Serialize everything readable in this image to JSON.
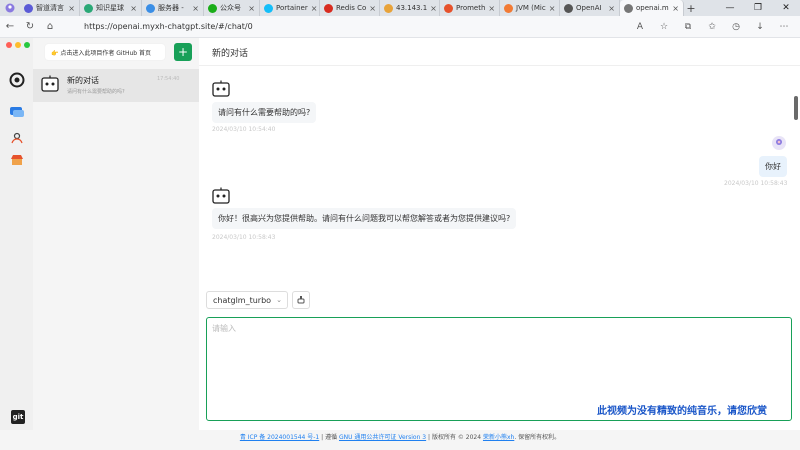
{
  "browser": {
    "tabs": [
      {
        "label": "智道清言",
        "color": "#5b5bd6"
      },
      {
        "label": "知识星球",
        "color": "#2aa876"
      },
      {
        "label": "服务器 - ",
        "color": "#3a8ee6"
      },
      {
        "label": "公众号",
        "color": "#1aad19"
      },
      {
        "label": "Portainer",
        "color": "#13bef9"
      },
      {
        "label": "Redis Co",
        "color": "#d82c20"
      },
      {
        "label": "43.143.1",
        "color": "#e8a33a"
      },
      {
        "label": "Prometh",
        "color": "#e6522c"
      },
      {
        "label": "JVM (Mic",
        "color": "#f27b35"
      },
      {
        "label": "OpenAI",
        "color": "#555555"
      },
      {
        "label": "openai.m",
        "color": "#777777"
      }
    ],
    "active_tab": 10,
    "url": "https://openai.myxh-chatgpt.site/#/chat/0"
  },
  "sidebar": {
    "github_label": "👉 点击进入此项目作者 GitHub 首页",
    "add_label": "+",
    "conversation": {
      "title": "新的对话",
      "time": "17:54:40",
      "subtitle": "请问有什么需要帮助的吗?"
    }
  },
  "main": {
    "title": "新的对话",
    "messages": [
      {
        "role": "bot",
        "text": "请问有什么需要帮助的吗?",
        "time": "2024/03/10 10:54:40"
      },
      {
        "role": "user",
        "text": "你好",
        "time": "2024/03/10 10:58:43"
      },
      {
        "role": "bot",
        "text": "你好！很高兴为您提供帮助。请问有什么问题我可以帮您解答或者为您提供建议吗?",
        "time": "2024/03/10 10:58:43"
      }
    ],
    "model": "chatglm_turbo",
    "placeholder": "请输入"
  },
  "footer": {
    "icp": "青 ICP 备 2024001544 号-1",
    "sep1": " | 遵循 ",
    "license": "GNU 通用公共许可证 Version 3",
    "mid": " | 版权所有 © 2024 ",
    "author": "荣新小熊xh",
    "end": ". 保留所有权利。"
  },
  "caption": "此视频为没有精致的纯音乐，请您欣赏",
  "colors": {
    "accent": "#18a058",
    "link": "#2080f0"
  }
}
